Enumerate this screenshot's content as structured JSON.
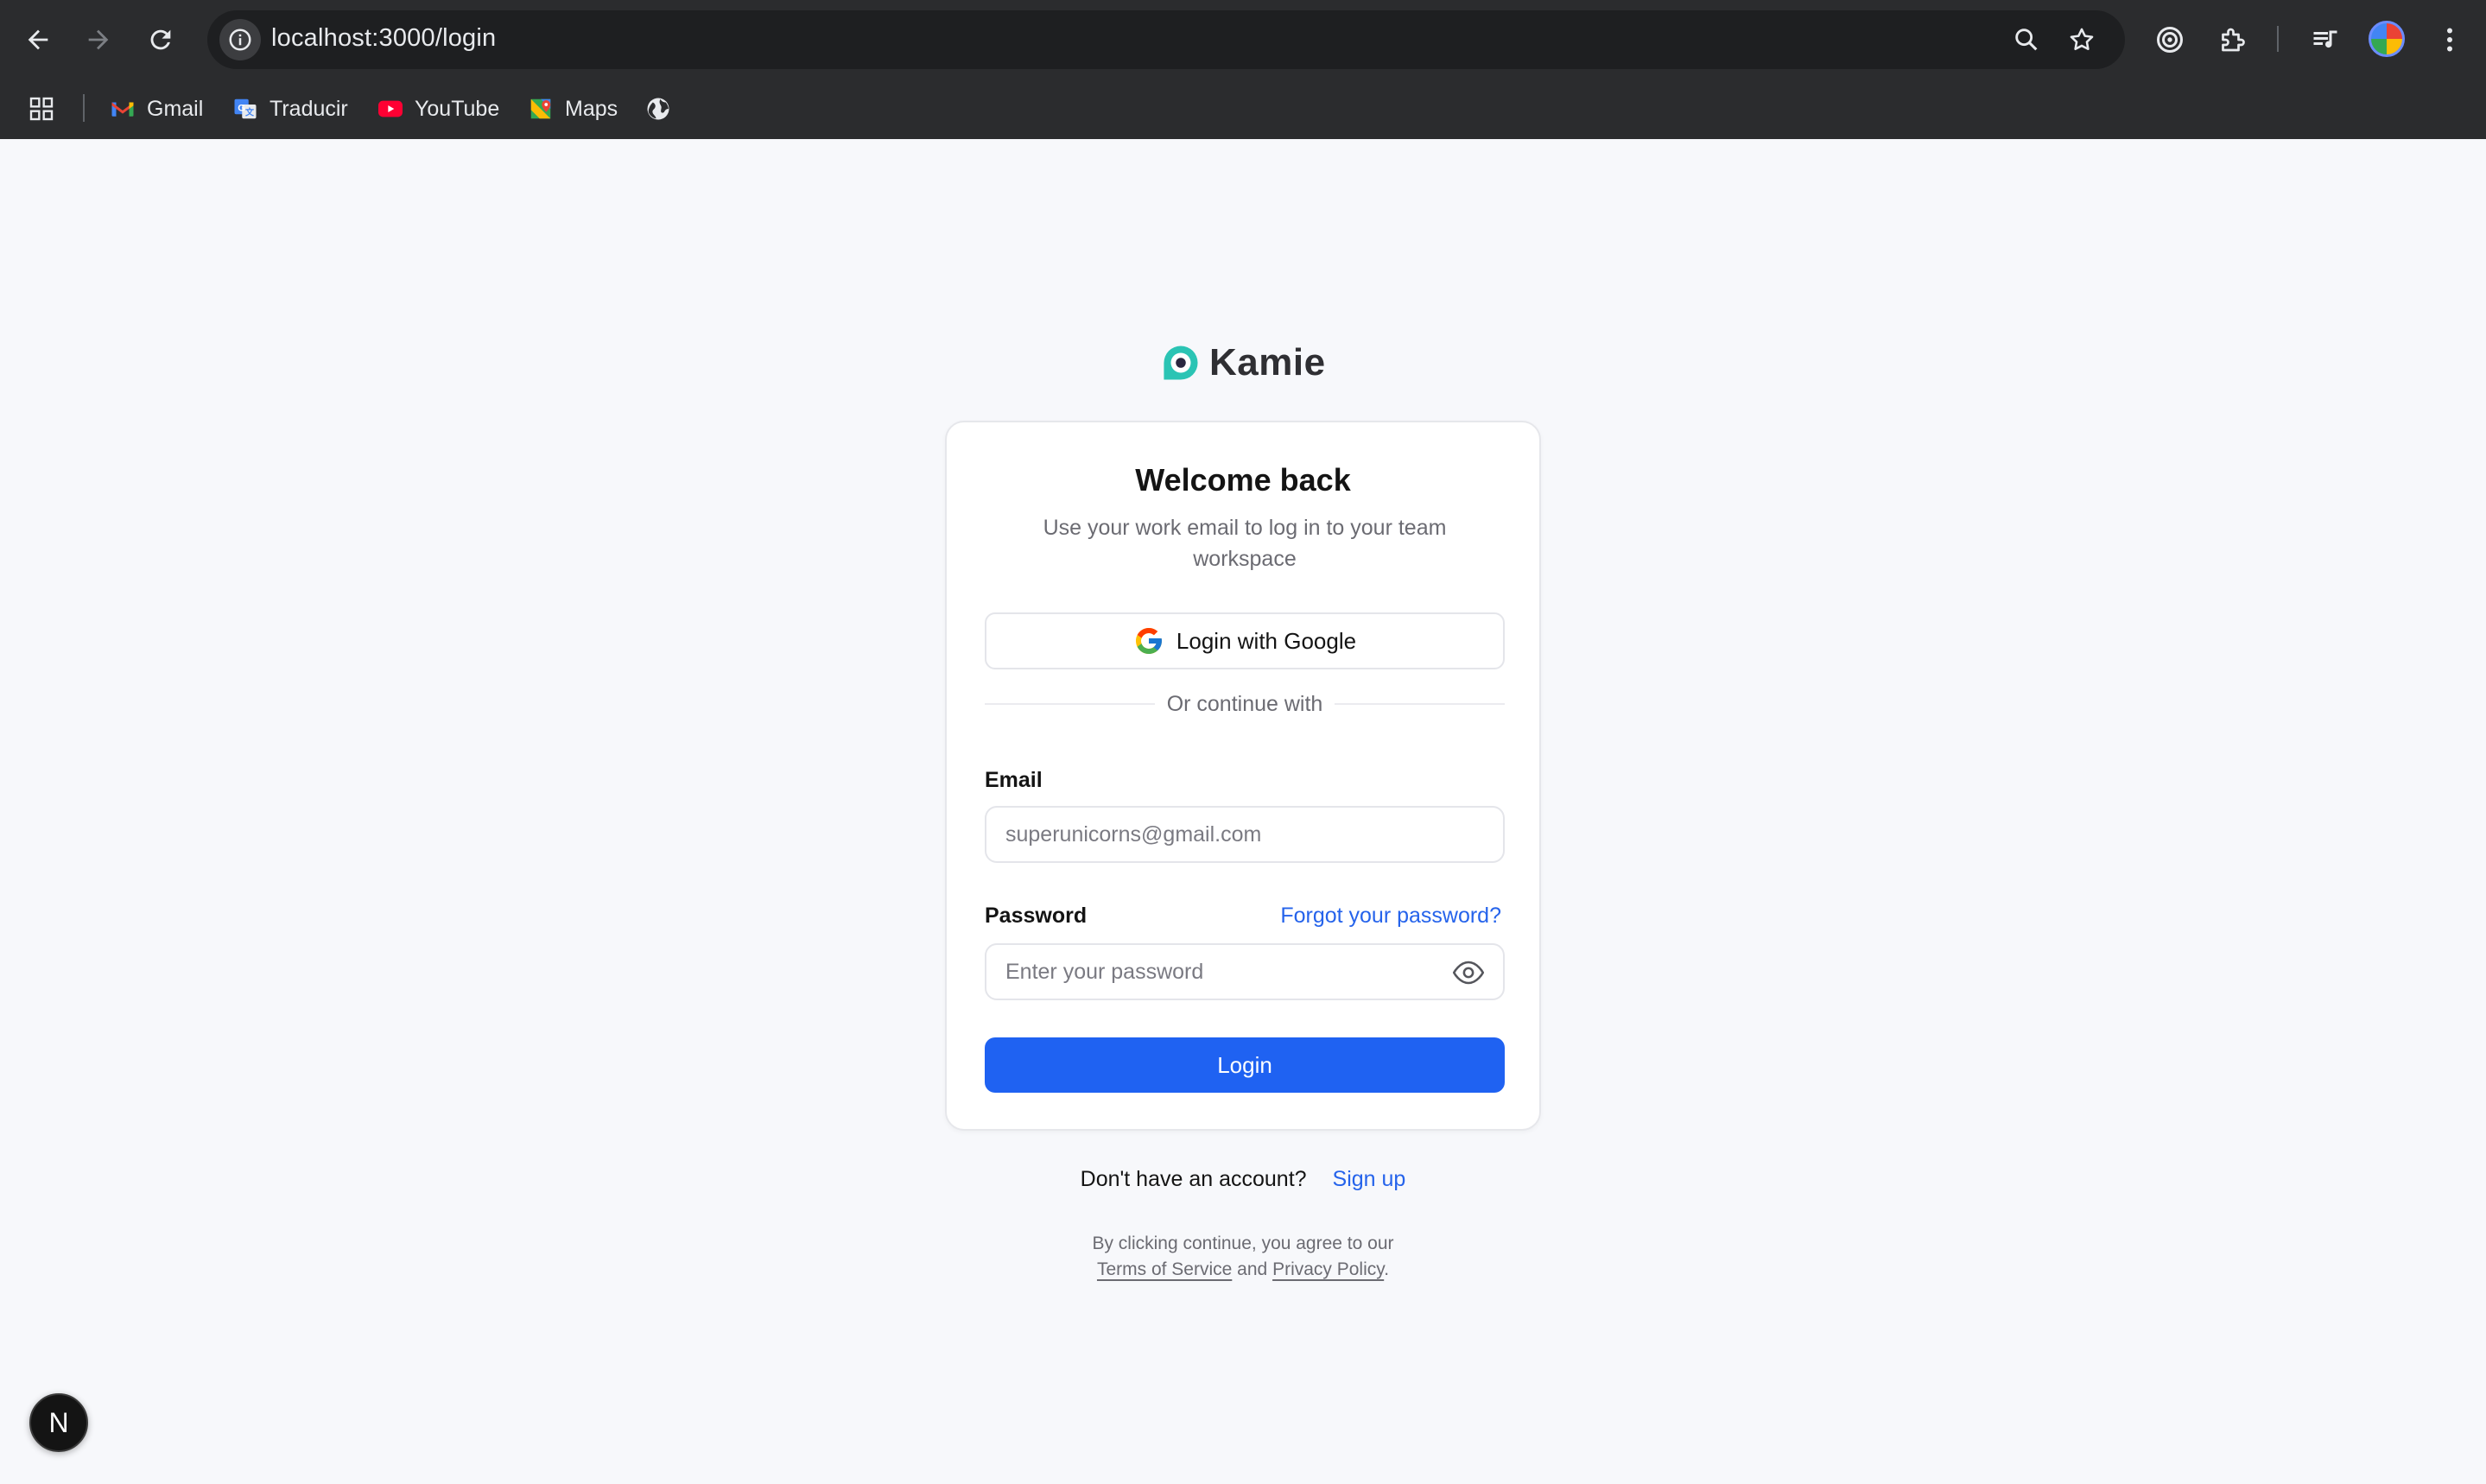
{
  "browser": {
    "url": "localhost:3000/login",
    "bookmarks": [
      {
        "label": "Gmail",
        "icon": "gmail-icon"
      },
      {
        "label": "Traducir",
        "icon": "translate-icon"
      },
      {
        "label": "YouTube",
        "icon": "youtube-icon"
      },
      {
        "label": "Maps",
        "icon": "maps-icon"
      }
    ]
  },
  "brand": {
    "name": "Kamie",
    "accent": "#2bc4b4"
  },
  "login": {
    "title": "Welcome back",
    "subtitle": "Use your work email to log in to your team workspace",
    "google_button": "Login with Google",
    "divider": "Or continue with",
    "email_label": "Email",
    "email_placeholder": "superunicorns@gmail.com",
    "password_label": "Password",
    "forgot_link": "Forgot your password?",
    "password_placeholder": "Enter your password",
    "submit": "Login"
  },
  "footer": {
    "signup_prompt": "Don't have an account?",
    "signup_link": "Sign up",
    "legal_prefix": "By clicking continue, you agree to our",
    "terms": "Terms of Service",
    "and": "and",
    "privacy": "Privacy Policy",
    "period": "."
  },
  "dev": {
    "badge": "N"
  },
  "colors": {
    "primary": "#1f62f2",
    "link": "#2563eb",
    "page_bg": "#f7f8fb"
  }
}
